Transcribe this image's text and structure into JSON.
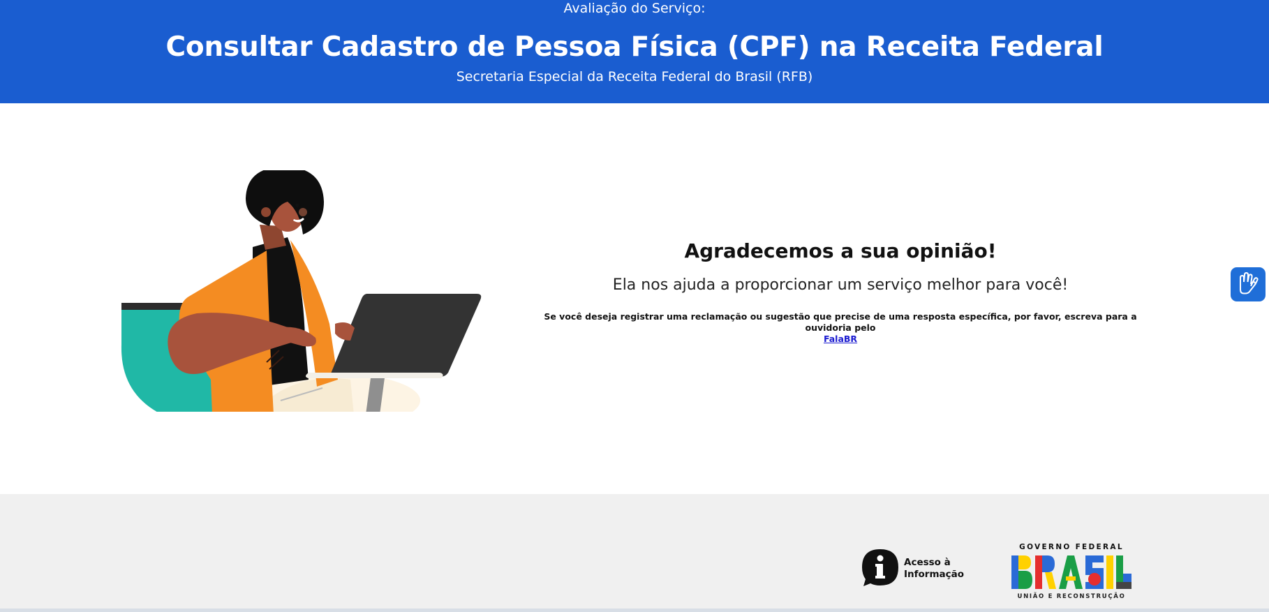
{
  "header": {
    "eyebrow": "Avaliação do Serviço:",
    "title": "Consultar Cadastro de Pessoa Física (CPF) na Receita Federal",
    "subtitle": "Secretaria Especial da Receita Federal do Brasil (RFB)",
    "background_color": "#1a5dd0"
  },
  "message": {
    "heading": "Agradecemos a sua opinião!",
    "lead": "Ela nos ajuda a proporcionar um serviço melhor para você!",
    "note": "Se você deseja registrar uma reclamação ou sugestão que precise de uma resposta específica, por favor, escreva para a ouvidoria pelo",
    "link_label": "FalaBR"
  },
  "accessibility_button": {
    "icon": "sign-language-hands-icon",
    "color": "#1f6ed8"
  },
  "footer": {
    "acesso_label_line1": "Acesso à",
    "acesso_label_line2": "Informação",
    "acesso_icon": "info-speech-bubble-icon",
    "gov_top": "GOVERNO FEDERAL",
    "gov_wordmark": "BRASIL",
    "gov_bottom": "UNIÃO E RECONSTRUÇÃO",
    "background_color": "#f0f0f0"
  }
}
